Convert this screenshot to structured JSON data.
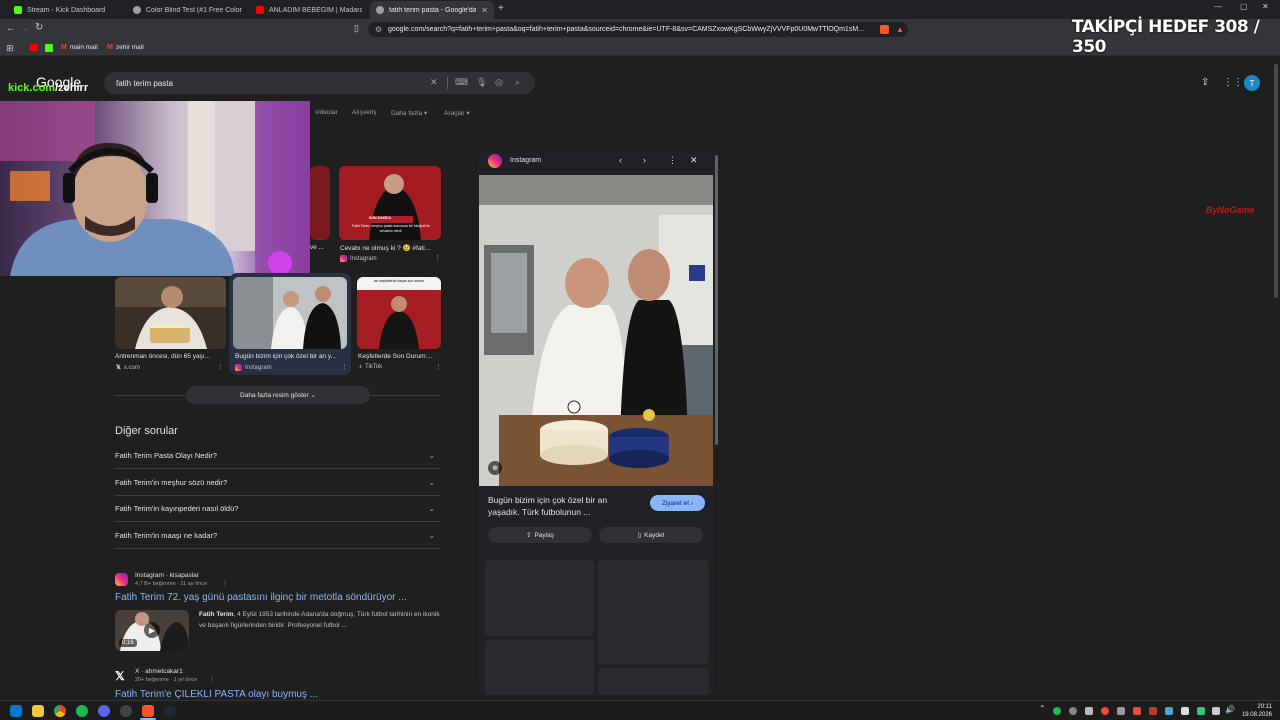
{
  "tabs": [
    {
      "label": "Stream - Kick Dashboard",
      "color": "#53fc18"
    },
    {
      "label": "Color Blind Test (#1 Free Color Blind...",
      "color": "#9aa0a6"
    },
    {
      "label": "ANLADIM BEBEĞİM | Madara Olduk",
      "color": "#ff0000"
    },
    {
      "label": "fatih terim pasta - Google'da Ara",
      "color": "#9aa0a6"
    }
  ],
  "omnibox": {
    "url": "google.com/search?q=fatih+terim+pasta&oq=fatih+terim+pasta&sourceid=chrome&ie=UTF-8&sv=CAMSZxowKgSCbWwyZjVVVFp0U0MwTTlOQm1sM..."
  },
  "bookmarks": [
    {
      "label": "main mail"
    },
    {
      "label": "zehir mail"
    }
  ],
  "stream": {
    "goal": "TAKİPÇİ HEDEF 308 / 350",
    "kick_brand": "kick.com",
    "kick_user": "/zehirr",
    "watermark": "ByNoGame"
  },
  "search": {
    "logo": "Google",
    "query": "fatih terim pasta"
  },
  "nav_tabs": [
    "videolar",
    "Alışveriş",
    "Daha fazla",
    "Araçlar"
  ],
  "images_row1": [
    {
      "caption": "ve ...",
      "source": ""
    },
    {
      "caption": "Cevabı ne olmuş ki ? 😢 #fati...",
      "source": "Instagram"
    }
  ],
  "images_row2": [
    {
      "caption": "Antrenman öncesi, dün 65 yaşı...",
      "source": "x.com"
    },
    {
      "caption": "Bugün bizim için çok özel bir an y...",
      "source": "Instagram"
    },
    {
      "caption": "Keşfetlerde Son Durum:...",
      "source": "TikTok"
    }
  ],
  "thumb_text": {
    "red1_caption": "Fatih Terim, meşhur pasta sorusuna bir fotoğraf ile cevabını verdi.",
    "red1_tag": "SON DAKİKA",
    "red2_caption": "acı keşfetlerde kaçan son durum"
  },
  "more_images": "Daha fazla resim göster",
  "paa": {
    "title": "Diğer sorular",
    "questions": [
      "Fatih Terim Pasta Olayı Nedir?",
      "Fatih Terim'in meşhur sözü nedir?",
      "Fatih Terim'in kayınpederi nasıl öldü?",
      "Fatih Terim'in maaşı ne kadar?"
    ]
  },
  "result1": {
    "site": "Instagram",
    "handle": "kisapaslar",
    "meta": "4,7 B+ beğenme · 11 ay önce",
    "title": "Fatih Terim 72. yaş günü pastasını ilginç bir metotla söndürüyor ...",
    "snippet_bold": "Fatih Terim",
    "snippet": ", 4 Eylül 1953 tarihinde Adana'da doğmuş, Türk futbol tarihinin en ikonik ve başarılı figürlerinden biridir. Profesyonel futbol ...",
    "duration": "0:16"
  },
  "result2": {
    "site": "X",
    "handle": "ahmetcakar1",
    "meta": "20+ beğenme · 1 yıl önce",
    "title": "Fatih Terim'e ÇİLEKLİ PASTA olayı buymuş ..."
  },
  "panel": {
    "source": "Instagram",
    "caption": "Bugün bizim için çok özel bir an yaşadık. Türk futbolunun ...",
    "visit": "Ziyaret et",
    "share": "Paylaş",
    "save": "Kaydet"
  },
  "taskbar": {
    "time": "20:11",
    "date": "19.08.2026"
  },
  "colors": {
    "bg": "#1f1f1f",
    "link": "#8ab4f8",
    "accent": "#8ab4f8"
  }
}
